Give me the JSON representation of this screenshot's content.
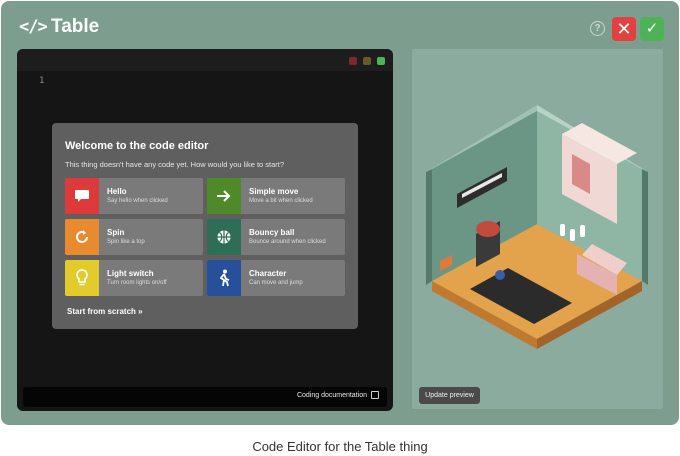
{
  "header": {
    "code_icon": "</>",
    "title": "Table",
    "help_symbol": "?",
    "close_symbol": "✕",
    "confirm_symbol": "✓"
  },
  "editor": {
    "line_numbers": [
      "1"
    ],
    "dialog": {
      "title": "Welcome to the code editor",
      "subtitle": "This thing doesn't have any code yet. How would you like to start?",
      "cards": [
        {
          "title": "Hello",
          "subtitle": "Say hello when clicked",
          "icon": "speech-bubble-icon",
          "color": "#dd3b3b"
        },
        {
          "title": "Simple move",
          "subtitle": "Move a bit when clicked",
          "icon": "arrow-right-icon",
          "color": "#4f8a2a"
        },
        {
          "title": "Spin",
          "subtitle": "Spin like a top",
          "icon": "rotate-icon",
          "color": "#e88a2e"
        },
        {
          "title": "Bouncy ball",
          "subtitle": "Bounce around when clicked",
          "icon": "basketball-icon",
          "color": "#2e6e56"
        },
        {
          "title": "Light switch",
          "subtitle": "Turn room lights on/off",
          "icon": "lightbulb-icon",
          "color": "#e3cb2d"
        },
        {
          "title": "Character",
          "subtitle": "Can move and jump",
          "icon": "walking-person-icon",
          "color": "#26509a"
        }
      ],
      "start_scratch": "Start from scratch »"
    },
    "footer": {
      "doc_link": "Coding documentation"
    }
  },
  "preview": {
    "update_button": "Update preview"
  },
  "caption": "Code Editor for the Table thing"
}
